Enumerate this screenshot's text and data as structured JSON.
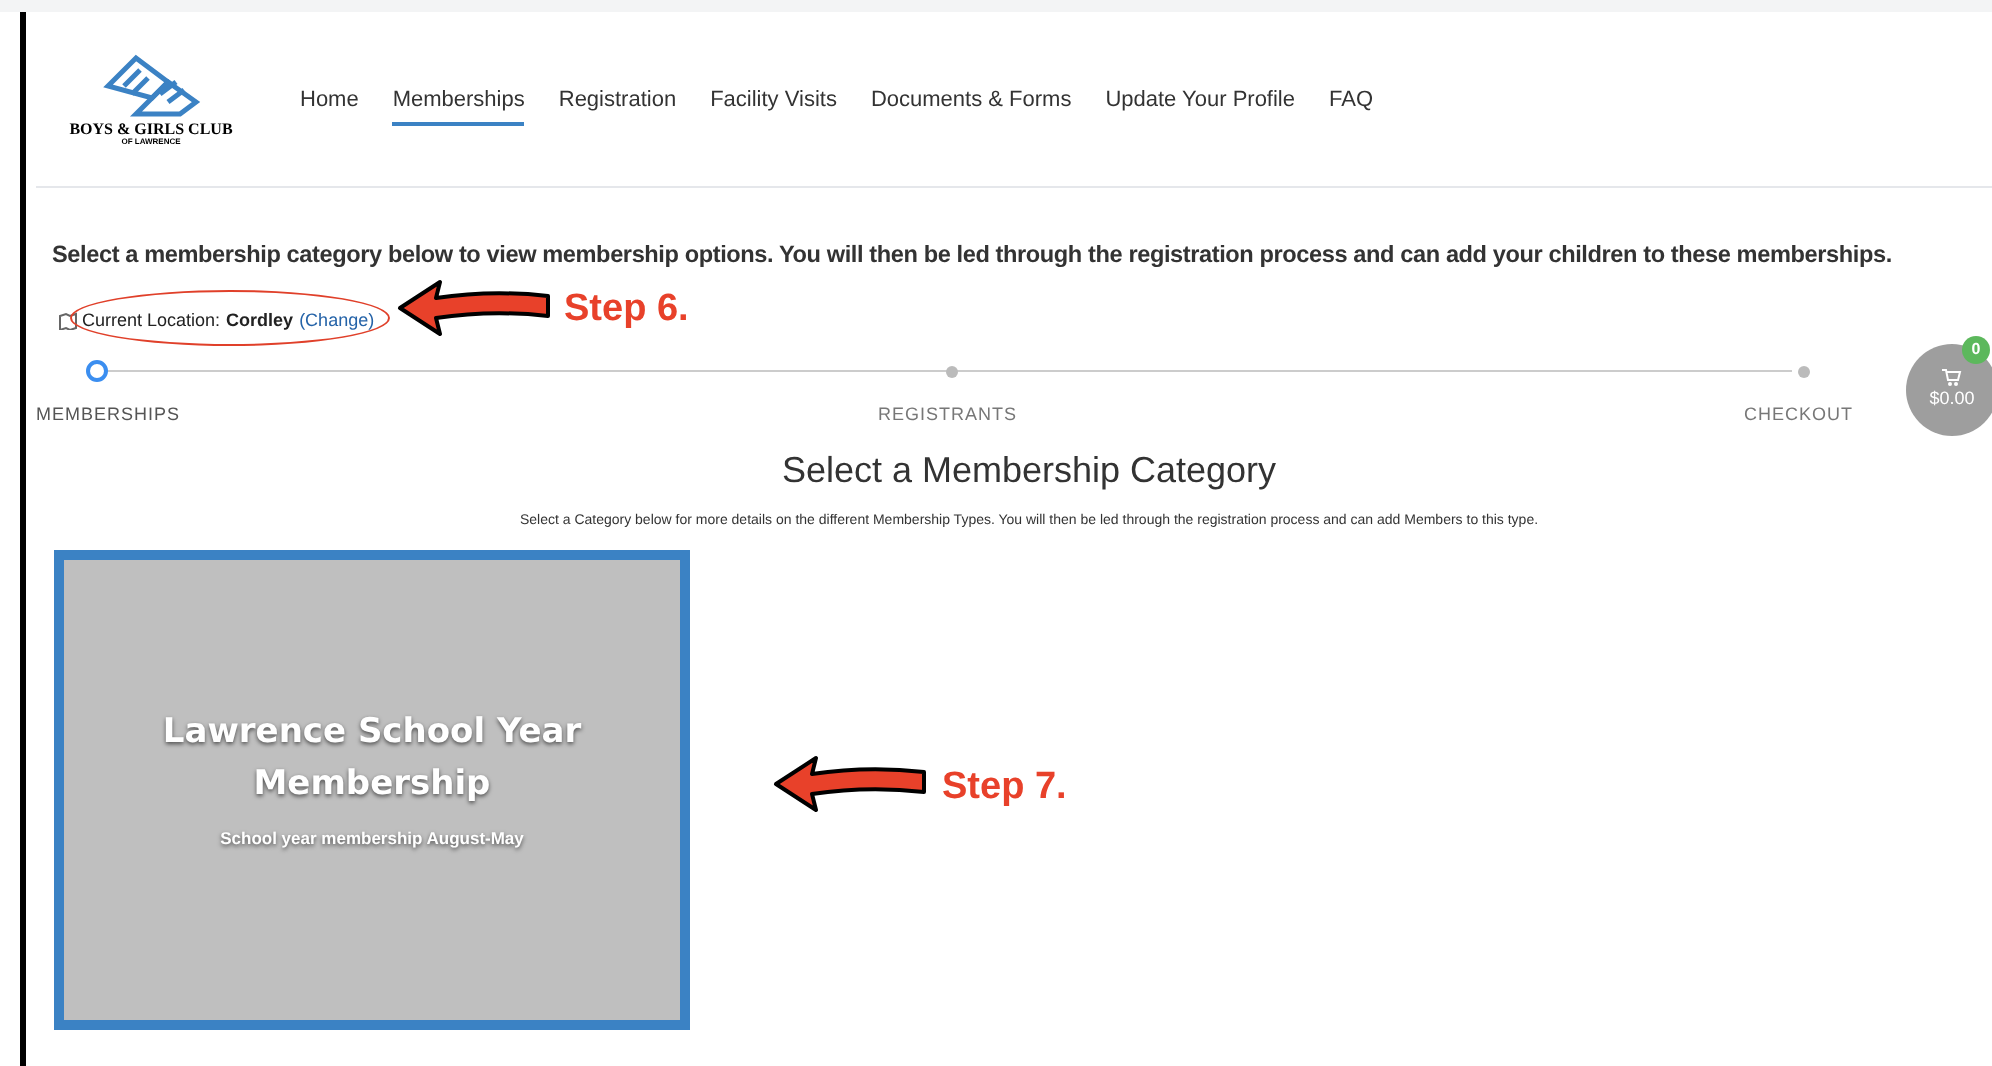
{
  "logo": {
    "name": "BOYS & GIRLS CLUB",
    "subtitle": "OF LAWRENCE"
  },
  "nav": [
    {
      "label": "Home",
      "selected": false
    },
    {
      "label": "Memberships",
      "selected": true
    },
    {
      "label": "Registration",
      "selected": false
    },
    {
      "label": "Facility Visits",
      "selected": false
    },
    {
      "label": "Documents & Forms",
      "selected": false
    },
    {
      "label": "Update Your Profile",
      "selected": false
    },
    {
      "label": "FAQ",
      "selected": false
    }
  ],
  "intro": "Select a membership category below to view membership options. You will then be led through the registration process and can add your children to these memberships.",
  "location": {
    "label": "Current Location:",
    "value": "Cordley",
    "link": "(Change)"
  },
  "steps": [
    {
      "label": "MEMBERSHIPS",
      "selected": true
    },
    {
      "label": "REGISTRANTS",
      "selected": false
    },
    {
      "label": "CHECKOUT",
      "selected": false
    }
  ],
  "cart": {
    "count": "0",
    "total": "$0.00"
  },
  "section": {
    "title": "Select a Membership Category",
    "subtitle": "Select a Category below for more details on the different Membership Types. You will then be led through the registration process and can add Members to this type."
  },
  "categories": [
    {
      "title": "Lawrence School Year Membership",
      "description": "School year membership August-May"
    }
  ],
  "annotations": [
    "Step 6.",
    "Step 7."
  ]
}
